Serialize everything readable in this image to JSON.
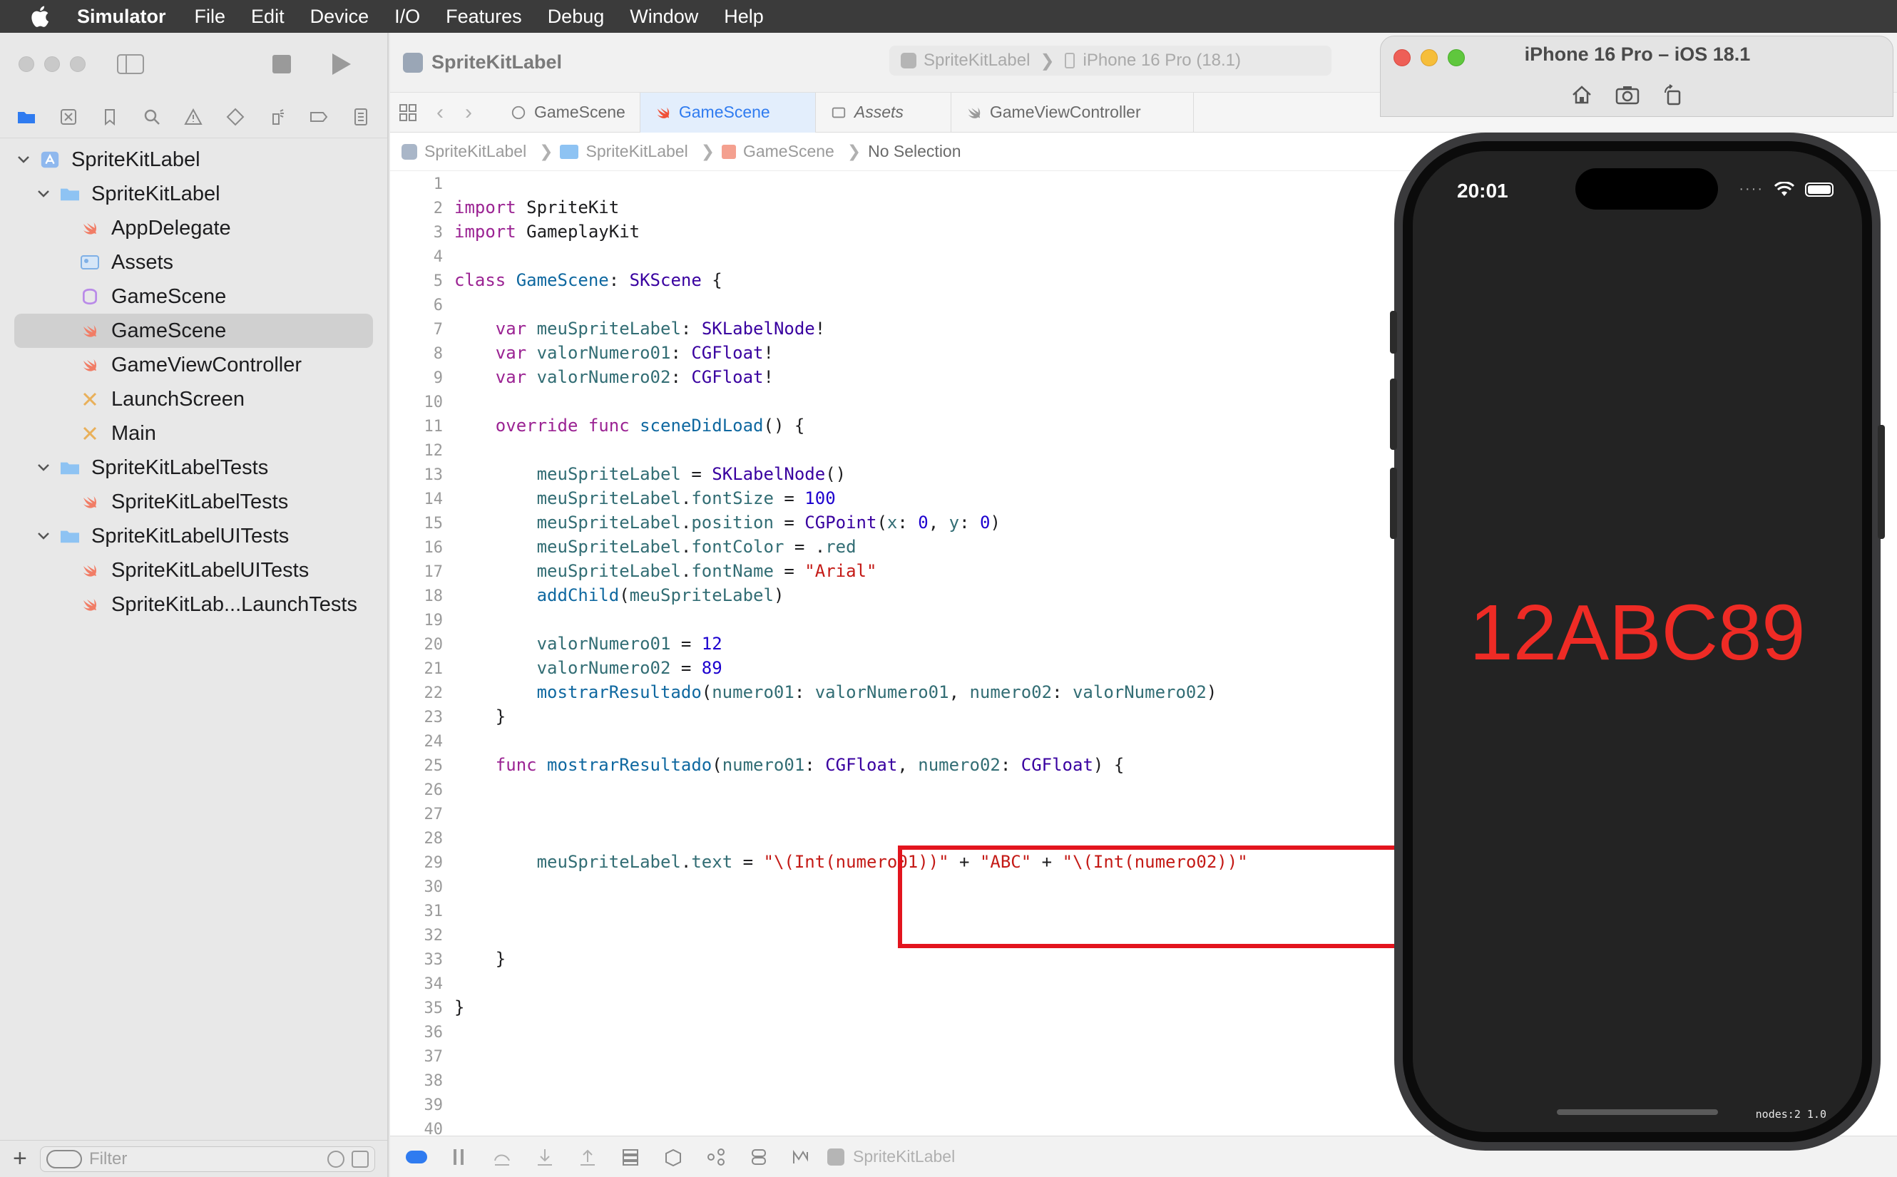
{
  "menubar": {
    "app": "Simulator",
    "items": [
      "File",
      "Edit",
      "Device",
      "I/O",
      "Features",
      "Debug",
      "Window",
      "Help"
    ]
  },
  "navigator": {
    "filter_placeholder": "Filter",
    "tree": [
      {
        "label": "SpriteKitLabel",
        "kind": "project",
        "expanded": true
      },
      {
        "label": "SpriteKitLabel",
        "kind": "folder",
        "expanded": true
      },
      {
        "label": "AppDelegate",
        "kind": "swift"
      },
      {
        "label": "Assets",
        "kind": "assets"
      },
      {
        "label": "GameScene",
        "kind": "sks"
      },
      {
        "label": "GameScene",
        "kind": "swift",
        "selected": true
      },
      {
        "label": "GameViewController",
        "kind": "swift"
      },
      {
        "label": "LaunchScreen",
        "kind": "storyboard"
      },
      {
        "label": "Main",
        "kind": "storyboard"
      },
      {
        "label": "SpriteKitLabelTests",
        "kind": "folder",
        "expanded": true
      },
      {
        "label": "SpriteKitLabelTests",
        "kind": "swift"
      },
      {
        "label": "SpriteKitLabelUITests",
        "kind": "folder",
        "expanded": true
      },
      {
        "label": "SpriteKitLabelUITests",
        "kind": "swift"
      },
      {
        "label": "SpriteKitLab...LaunchTests",
        "kind": "swift"
      }
    ]
  },
  "editor": {
    "title": "SpriteKitLabel",
    "scheme": "SpriteKitLabel",
    "destination": "iPhone 16 Pro (18.1)",
    "tabs": [
      {
        "label": "GameScene",
        "active": false
      },
      {
        "label": "GameScene",
        "active": true
      },
      {
        "label": "Assets",
        "active": false
      },
      {
        "label": "GameViewController",
        "active": false
      }
    ],
    "breadcrumb": [
      "SpriteKitLabel",
      "SpriteKitLabel",
      "GameScene",
      "No Selection"
    ],
    "debug_target": "SpriteKitLabel",
    "code_lines": [
      "",
      "import SpriteKit",
      "import GameplayKit",
      "",
      "class GameScene: SKScene {",
      "",
      "    var meuSpriteLabel: SKLabelNode!",
      "    var valorNumero01: CGFloat!",
      "    var valorNumero02: CGFloat!",
      "",
      "    override func sceneDidLoad() {",
      "",
      "        meuSpriteLabel = SKLabelNode()",
      "        meuSpriteLabel.fontSize = 100",
      "        meuSpriteLabel.position = CGPoint(x: 0, y: 0)",
      "        meuSpriteLabel.fontColor = .red",
      "        meuSpriteLabel.fontName = \"Arial\"",
      "        addChild(meuSpriteLabel)",
      "",
      "        valorNumero01 = 12",
      "        valorNumero02 = 89",
      "        mostrarResultado(numero01: valorNumero01, numero02: valorNumero02)",
      "    }",
      "",
      "    func mostrarResultado(numero01: CGFloat, numero02: CGFloat) {",
      "",
      "",
      "",
      "        meuSpriteLabel.text = \"\\(Int(numero01))\" + \"ABC\" + \"\\(Int(numero02))\"",
      "",
      "",
      "",
      "    }",
      "",
      "}",
      "",
      "",
      "",
      "",
      ""
    ]
  },
  "simulator": {
    "title": "iPhone 16 Pro – iOS 18.1",
    "time": "20:01",
    "label_text": "12ABC89",
    "label_color": "#ee2b25",
    "nodes_text": "nodes:2  1.0"
  }
}
